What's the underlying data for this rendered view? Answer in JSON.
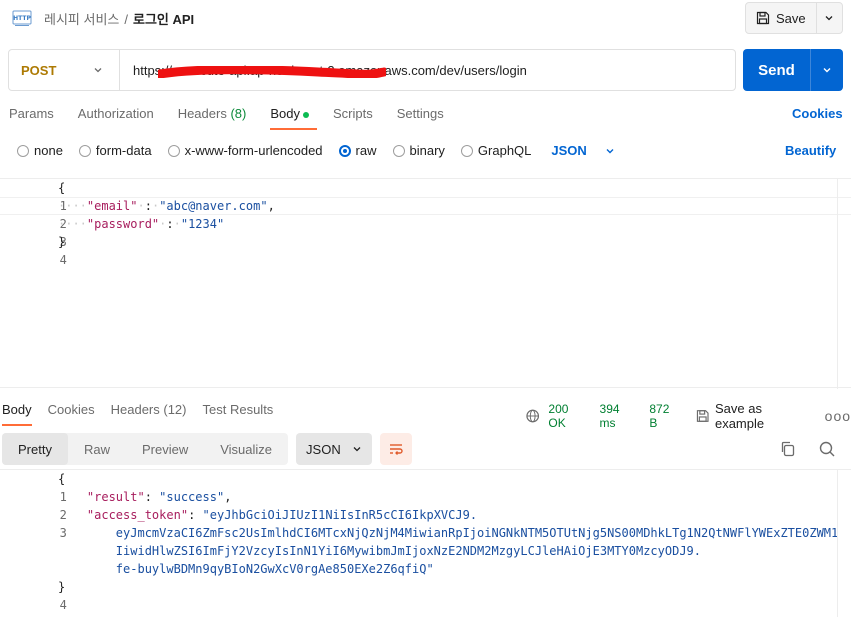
{
  "header": {
    "breadcrumb_parent": "레시피 서비스",
    "breadcrumb_sep": "/",
    "breadcrumb_current": "로그인 API",
    "save_label": "Save"
  },
  "request": {
    "method": "POST",
    "url": "https://          .execute-api.ap-northeast-2.amazonaws.com/dev/users/login",
    "send_label": "Send"
  },
  "request_tabs": [
    {
      "label": "Params",
      "count": ""
    },
    {
      "label": "Authorization",
      "count": ""
    },
    {
      "label": "Headers",
      "count": "(8)"
    },
    {
      "label": "Body",
      "count": ""
    },
    {
      "label": "Scripts",
      "count": ""
    },
    {
      "label": "Settings",
      "count": ""
    }
  ],
  "cookies_label": "Cookies",
  "body_types": [
    {
      "label": "none",
      "checked": false
    },
    {
      "label": "form-data",
      "checked": false
    },
    {
      "label": "x-www-form-urlencoded",
      "checked": false
    },
    {
      "label": "raw",
      "checked": true
    },
    {
      "label": "binary",
      "checked": false
    },
    {
      "label": "GraphQL",
      "checked": false
    }
  ],
  "body_format": "JSON",
  "beautify_label": "Beautify",
  "request_body": {
    "line_numbers": [
      "1",
      "2",
      "3",
      "4"
    ],
    "open_brace": "{",
    "close_brace": "}",
    "email_key": "\"email\"",
    "email_value": "\"abc@naver.com\"",
    "password_key": "\"password\"",
    "password_value": "\"1234\""
  },
  "response_tabs": [
    {
      "label": "Body",
      "count": ""
    },
    {
      "label": "Cookies",
      "count": ""
    },
    {
      "label": "Headers",
      "count": "(12)"
    },
    {
      "label": "Test Results",
      "count": ""
    }
  ],
  "response_status": {
    "status": "200 OK",
    "time": "394 ms",
    "size": "872 B",
    "save_example_label": "Save as example",
    "more": "ooo"
  },
  "response_views": [
    "Pretty",
    "Raw",
    "Preview",
    "Visualize"
  ],
  "response_format": "JSON",
  "response_body": {
    "line_numbers": [
      "1",
      "2",
      "3",
      "4"
    ],
    "open_brace": "{",
    "close_brace": "}",
    "result_key": "\"result\"",
    "result_value": "\"success\"",
    "token_key": "\"access_token\"",
    "token_line1": "\"eyJhbGciOiJIUzI1NiIsInR5cCI6IkpXVCJ9.",
    "token_line2": "eyJmcmVzaCI6ZmFsc2UsImlhdCI6MTcxNjQzNjM4MiwianRpIjoiNGNkNTM5OTUtNjg5NS00MDhkLTg1N2QtNWFlYWExZTE0ZWM1",
    "token_line3": "IiwidHlwZSI6ImFjY2VzcyIsInN1YiI6MywibmJmIjoxNzE2NDM2MzgyLCJleHAiOjE3MTY0MzcyODJ9.",
    "token_line4": "fe-buylwBDMn9qyBIoN2GwXcV0rgAe850EXe2Z6qfiQ\""
  },
  "colors": {
    "method": "#ad7a03",
    "send": "#0265d2",
    "link": "#0265d2",
    "status_ok": "#007f31",
    "active_tab": "#ff6c37"
  }
}
